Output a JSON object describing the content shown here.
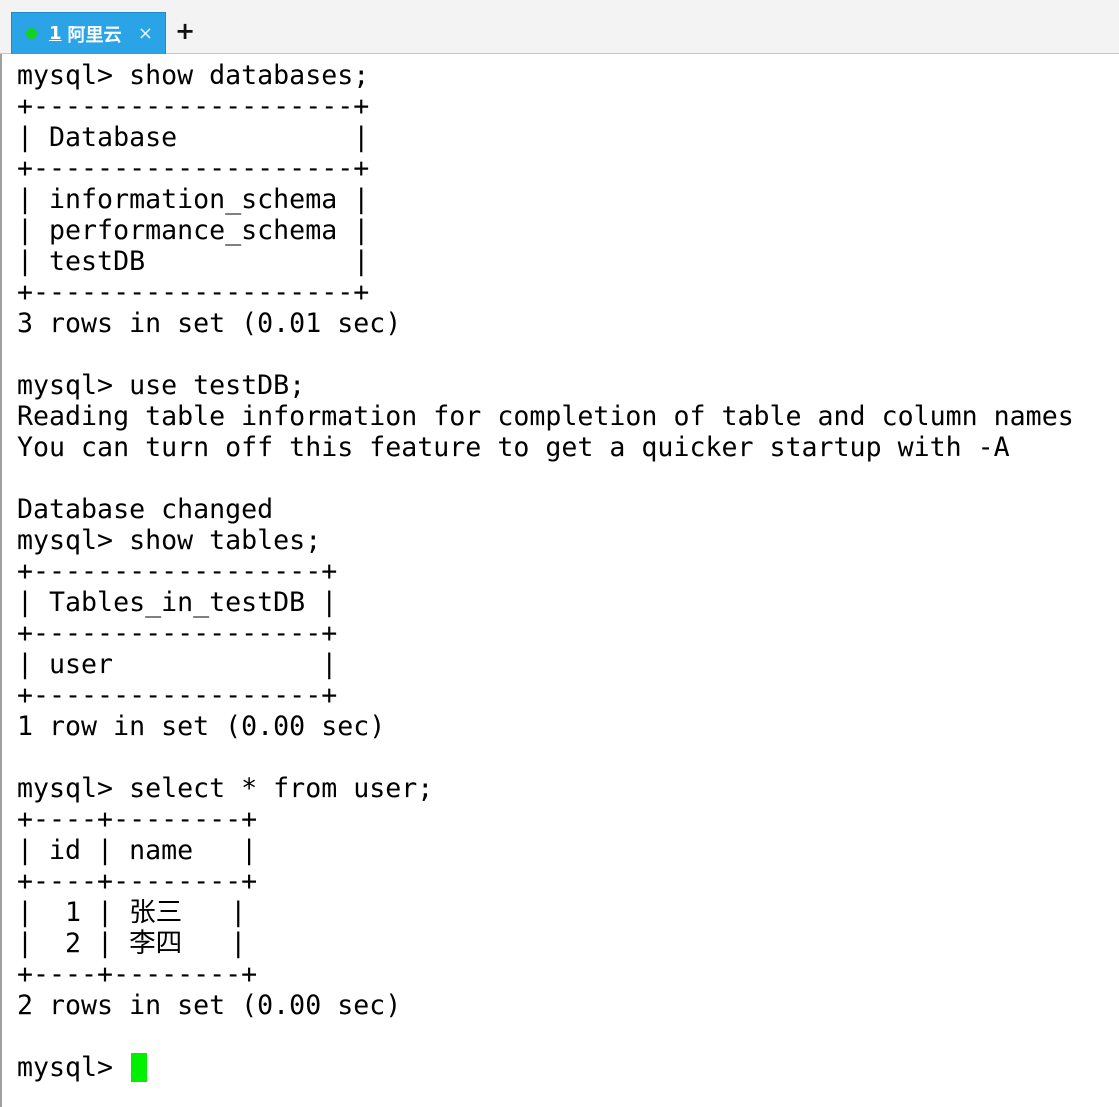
{
  "tabbar": {
    "tab": {
      "number": "1",
      "title": "阿里云",
      "close_glyph": "×",
      "status_color": "#13d31a",
      "color": "#2aa4e6"
    },
    "new_tab_glyph": "+"
  },
  "terminal": {
    "lines": [
      "mysql> show databases;",
      "+--------------------+",
      "| Database           |",
      "+--------------------+",
      "| information_schema |",
      "| performance_schema |",
      "| testDB             |",
      "+--------------------+",
      "3 rows in set (0.01 sec)",
      "",
      "mysql> use testDB;",
      "Reading table information for completion of table and column names",
      "You can turn off this feature to get a quicker startup with -A",
      "",
      "Database changed",
      "mysql> show tables;",
      "+------------------+",
      "| Tables_in_testDB |",
      "+------------------+",
      "| user             |",
      "+------------------+",
      "1 row in set (0.00 sec)",
      "",
      "mysql> select * from user;",
      "+----+--------+",
      "| id | name   |",
      "+----+--------+",
      "|  1 | 张三   |",
      "|  2 | 李四   |",
      "+----+--------+",
      "2 rows in set (0.00 sec)",
      ""
    ],
    "prompt": "mysql> ",
    "cursor_color": "#00f000"
  }
}
